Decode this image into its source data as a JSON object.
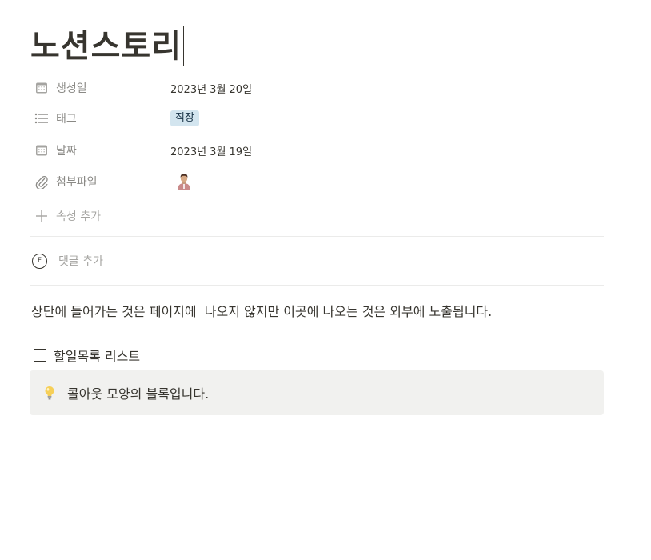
{
  "page": {
    "title": "노션스토리"
  },
  "properties": [
    {
      "icon": "calendar-icon",
      "label": "생성일",
      "value": "2023년 3월 20일"
    },
    {
      "icon": "list-icon",
      "label": "태그",
      "tag": "직장",
      "tag_color": "#d3e5ef"
    },
    {
      "icon": "calendar-icon",
      "label": "날짜",
      "value": "2023년 3월 19일"
    },
    {
      "icon": "paperclip-icon",
      "label": "첨부파일",
      "attachment": "person-thumbnail"
    }
  ],
  "add_property_label": "속성 추가",
  "comment": {
    "avatar_letter": "F",
    "placeholder": "댓글 추가"
  },
  "content": {
    "paragraph": "상단에 들어가는 것은 페이지에  나오지 않지만 이곳에 나오는 것은 외부에 노출됩니다.",
    "todo_label": "할일목록 리스트",
    "todo_checked": false,
    "callout_icon": "lightbulb-icon",
    "callout_text": "콜아웃 모양의 블록입니다."
  },
  "colors": {
    "text": "#37352f",
    "muted": "#8a8985",
    "callout_bg": "#f1f1ef",
    "tag_bg": "#d3e5ef"
  }
}
